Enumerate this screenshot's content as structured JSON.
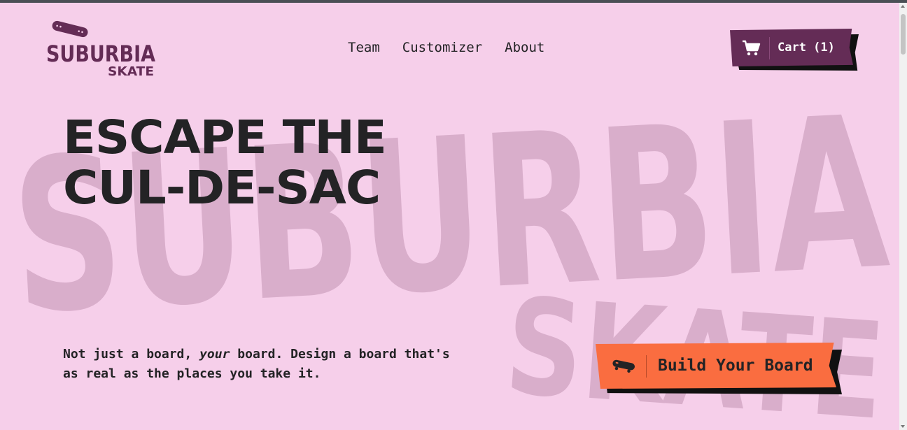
{
  "brand": {
    "logo_main": "SUBURBIA",
    "logo_sub": "SKATE",
    "watermark_main": "SUBURBIA",
    "watermark_sub": "SKATE"
  },
  "nav": {
    "items": [
      {
        "label": "Team"
      },
      {
        "label": "Customizer"
      },
      {
        "label": "About"
      }
    ]
  },
  "cart": {
    "label": "Cart (1)",
    "icon": "shopping-cart-icon"
  },
  "hero": {
    "headline_line1": "ESCAPE THE",
    "headline_line2": "CUL-DE-SAC",
    "tagline_pre": "Not just a board, ",
    "tagline_emphasis": "your",
    "tagline_post": " board. Design a board that's as real as the places you take it.",
    "cta_label": "Build Your Board",
    "cta_icon": "skateboard-icon"
  },
  "colors": {
    "background": "#f6cfea",
    "brand_purple": "#642c56",
    "cta_orange": "#fa6d40",
    "text_dark": "#232325",
    "watermark": "#d9aecb"
  }
}
